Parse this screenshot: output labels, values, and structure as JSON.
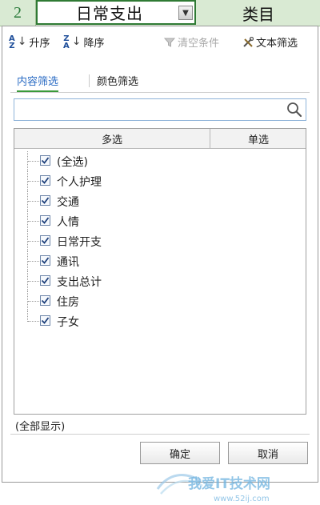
{
  "sheet": {
    "row_number": "2",
    "cell_a_value": "日常支出",
    "cell_b_value": "类目"
  },
  "toolbar": {
    "sort_asc": "升序",
    "sort_desc": "降序",
    "clear_filter": "清空条件",
    "text_filter": "文本筛选"
  },
  "tabs": [
    {
      "label": "内容筛选",
      "active": true
    },
    {
      "label": "颜色筛选",
      "active": false
    }
  ],
  "search": {
    "value": "",
    "placeholder": ""
  },
  "list": {
    "header_multi": "多选",
    "header_single": "单选",
    "items": [
      {
        "label": "(全选)",
        "checked": true
      },
      {
        "label": "个人护理",
        "checked": true
      },
      {
        "label": "交通",
        "checked": true
      },
      {
        "label": "人情",
        "checked": true
      },
      {
        "label": "日常开支",
        "checked": true
      },
      {
        "label": "通讯",
        "checked": true
      },
      {
        "label": "支出总计",
        "checked": true
      },
      {
        "label": "住房",
        "checked": true
      },
      {
        "label": "子女",
        "checked": true
      }
    ]
  },
  "status": "(全部显示)",
  "buttons": {
    "ok": "确定",
    "cancel": "取消"
  },
  "watermark": {
    "text": "我爱IT技术网",
    "url": "www.52ij.com"
  },
  "colors": {
    "accent": "#2b6cc4",
    "sheet_green": "#d9ead3",
    "tab_underline": "#3a9a3a"
  }
}
